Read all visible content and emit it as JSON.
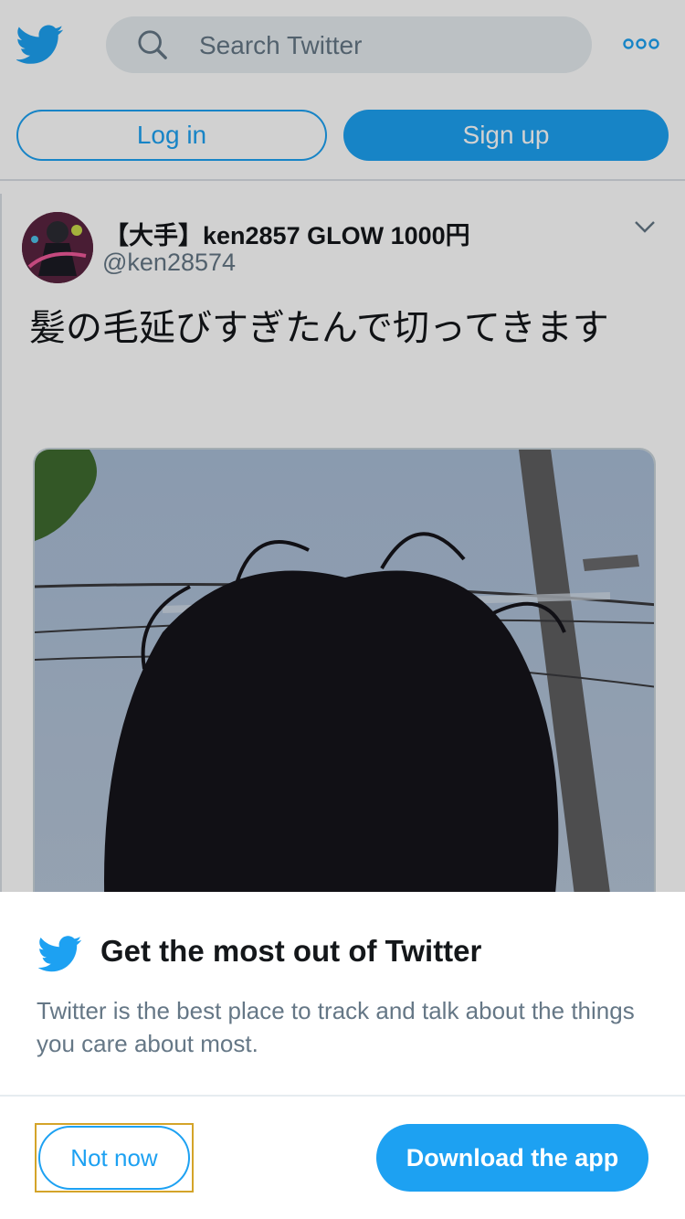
{
  "header": {
    "logo_icon": "twitter-bird-icon",
    "search": {
      "placeholder": "Search Twitter",
      "icon": "search-icon"
    },
    "more_icon": "more-options-icon",
    "login_label": "Log in",
    "signup_label": "Sign up"
  },
  "tweet": {
    "author_name": "【大手】ken2857 GLOW 1000円",
    "author_handle": "@ken28574",
    "text": "髪の毛延びすぎたんで切ってきます",
    "avatar_icon": "avatar",
    "caret_icon": "chevron-down-icon",
    "media_icon": "photo"
  },
  "sheet": {
    "title": "Get the most out of Twitter",
    "body": "Twitter is the best place to track and talk about the things you care about most.",
    "not_now_label": "Not now",
    "download_label": "Download the app"
  },
  "colors": {
    "brand_blue": "#1da1f2",
    "secondary_text": "#657786",
    "primary_text": "#14171a",
    "focus_outline": "#d4a429"
  }
}
